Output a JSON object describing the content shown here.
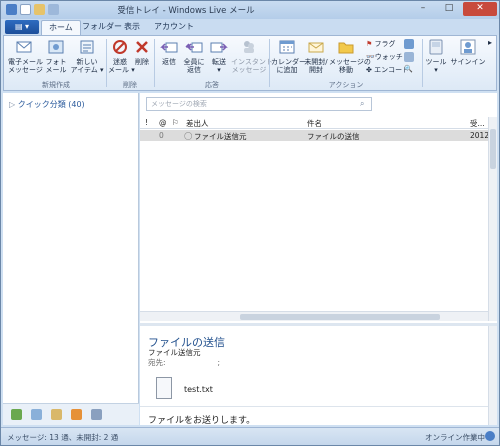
{
  "window": {
    "title": "受信トレイ - Windows Live メール",
    "minimize": "–",
    "maximize": "□",
    "close": "✕"
  },
  "tabs": [
    {
      "label": "ホーム"
    },
    {
      "label": "フォルダー"
    },
    {
      "label": "表示"
    },
    {
      "label": "アカウント"
    }
  ],
  "ribbon": {
    "new_email": "電子メール\nメッセージ",
    "new_photo": "フォト\nメール",
    "new_item": "新しい\nアイテム ▾",
    "junk": "迷惑\nメール ▾",
    "delete": "削除",
    "reply": "返信",
    "reply_all": "全員に\n返信",
    "forward": "転送\n▾",
    "instant": "インスタント\nメッセージ",
    "calendar": "カレンダー\nに追加",
    "unread": "未開封/\n開封",
    "move": "メッセージの\n移動",
    "flag": "フラグ",
    "watch": "ウォッチ",
    "encode": "エンコード",
    "tools": "ツール\n▾",
    "signin": "サインイン",
    "groups": {
      "new": "新規作成",
      "delete": "削除",
      "respond": "応答",
      "actions": "アクション"
    }
  },
  "leftpane": {
    "quick_views": "クイック分類 (40)"
  },
  "search": {
    "placeholder": "メッセージの検索"
  },
  "list": {
    "headers": {
      "flag": "!",
      "attach": "@",
      "flag2": "⚐",
      "from": "差出人",
      "subject": "件名",
      "received": "受..."
    },
    "rows": [
      {
        "from": "ファイル送信元",
        "subject": "ファイルの送信",
        "received": "2012"
      }
    ]
  },
  "preview": {
    "subject": "ファイルの送信",
    "from": "ファイル送信元",
    "to_label": "宛先:",
    "to_value": ";",
    "attachment": "test.txt",
    "body": "ファイルをお送りします。"
  },
  "status": {
    "counts": "メッセージ: 13 通、未開封: 2 通",
    "online": "オンライン作業中"
  }
}
